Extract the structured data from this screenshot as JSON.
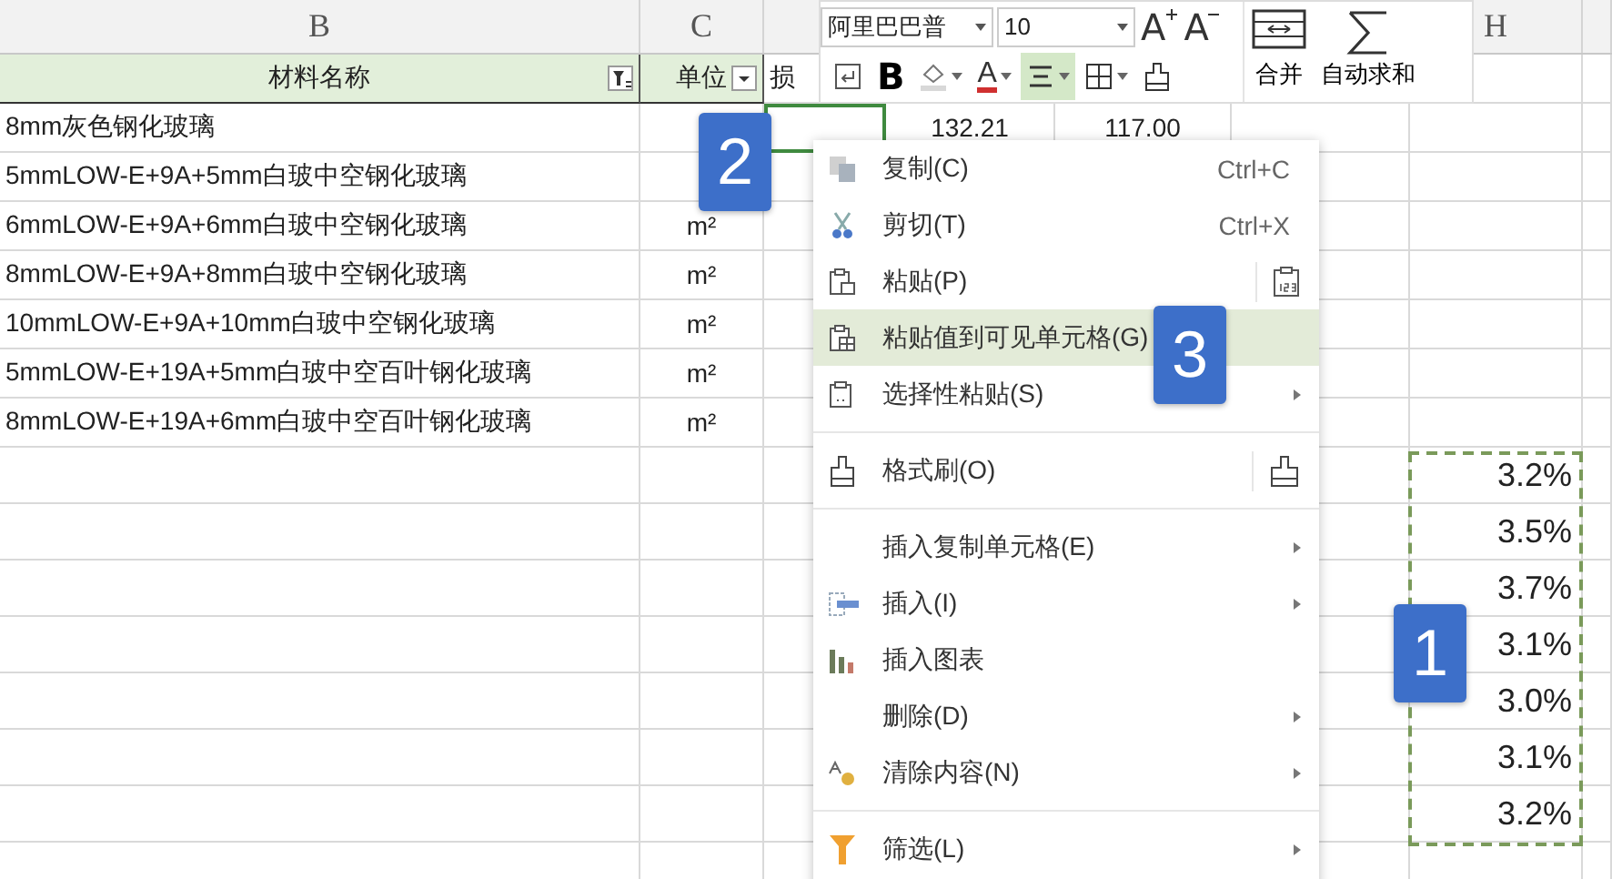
{
  "column_headers": [
    "B",
    "C",
    "H"
  ],
  "table": {
    "header": [
      {
        "text": "材料名称",
        "filter": true
      },
      {
        "text": "单位",
        "dropdown": true
      },
      {
        "text": "损"
      }
    ],
    "rows": [
      {
        "name": "8mm灰色钢化玻璃",
        "value_1": "132.21",
        "value_2": "117.00",
        "selected": true
      },
      {
        "name": "5mmLOW-E+9A+5mm白玻中空钢化玻璃",
        "selected": false
      },
      {
        "name": "6mmLOW-E+9A+6mm白玻中空钢化玻璃",
        "unit": "m²",
        "selected": false
      },
      {
        "name": "8mmLOW-E+9A+8mm白玻中空钢化玻璃",
        "unit": "m²",
        "selected": false
      },
      {
        "name": "10mmLOW-E+9A+10mm白玻中空钢化玻璃",
        "unit": "m²",
        "selected": false
      },
      {
        "name": "5mmLOW-E+19A+5mm白玻中空百叶钢化玻璃",
        "unit": "m²",
        "selected": false
      },
      {
        "name": "8mmLOW-E+19A+6mm白玻中空百叶钢化玻璃",
        "unit": "m²",
        "selected": false
      }
    ]
  },
  "percentages": [
    "3.2%",
    "3.5%",
    "3.7%",
    "3.1%",
    "3.0%",
    "3.1%",
    "3.2%"
  ],
  "mini_toolbar": {
    "font_family": "阿里巴巴普",
    "font_size": "10",
    "size_buttons": [
      {
        "label": "A",
        "kind": "grow"
      },
      {
        "label": "A",
        "kind": "shrink"
      }
    ],
    "tools": [
      {
        "kind": "wrap",
        "selected": false
      },
      {
        "kind": "bold",
        "label": "B",
        "selected": false
      },
      {
        "kind": "fill",
        "selected": false
      },
      {
        "kind": "font-color",
        "label": "A",
        "selected": false
      },
      {
        "kind": "align-center",
        "selected": true
      },
      {
        "kind": "borders",
        "selected": false
      },
      {
        "kind": "format-painter",
        "selected": false
      }
    ],
    "big_buttons": [
      {
        "kind": "merge",
        "label": "合并"
      },
      {
        "kind": "autosum",
        "label": "自动求和"
      }
    ]
  },
  "context_menu": [
    {
      "kind": "copy",
      "label": "复制(C)",
      "shortcut": "Ctrl+C",
      "submenu": false,
      "selected": false,
      "separator_before": false
    },
    {
      "kind": "cut",
      "label": "剪切(T)",
      "shortcut": "Ctrl+X",
      "submenu": false,
      "selected": false,
      "separator_before": false
    },
    {
      "kind": "paste",
      "label": "粘贴(P)",
      "submenu": false,
      "selected": false,
      "separator_before": false
    },
    {
      "kind": "paste-visible",
      "label": "粘贴值到可见单元格(G)",
      "submenu": false,
      "selected": true,
      "separator_before": false
    },
    {
      "kind": "paste-special",
      "label": "选择性粘贴(S)",
      "submenu": true,
      "selected": false,
      "separator_before": false
    },
    {
      "kind": "format-painter",
      "label": "格式刷(O)",
      "submenu": false,
      "selected": false,
      "separator_before": true
    },
    {
      "kind": "insert-copied",
      "label": "插入复制单元格(E)",
      "submenu": true,
      "selected": false,
      "separator_before": true
    },
    {
      "kind": "insert",
      "label": "插入(I)",
      "submenu": true,
      "selected": false,
      "separator_before": false
    },
    {
      "kind": "chart",
      "label": "插入图表",
      "submenu": false,
      "selected": false,
      "separator_before": false
    },
    {
      "kind": "delete",
      "label": "删除(D)",
      "submenu": true,
      "selected": false,
      "separator_before": false
    },
    {
      "kind": "clear",
      "label": "清除内容(N)",
      "submenu": true,
      "selected": false,
      "separator_before": false
    },
    {
      "kind": "filter",
      "label": "筛选(L)",
      "submenu": true,
      "selected": false,
      "separator_before": true
    }
  ],
  "badges": [
    "1",
    "2",
    "3"
  ]
}
